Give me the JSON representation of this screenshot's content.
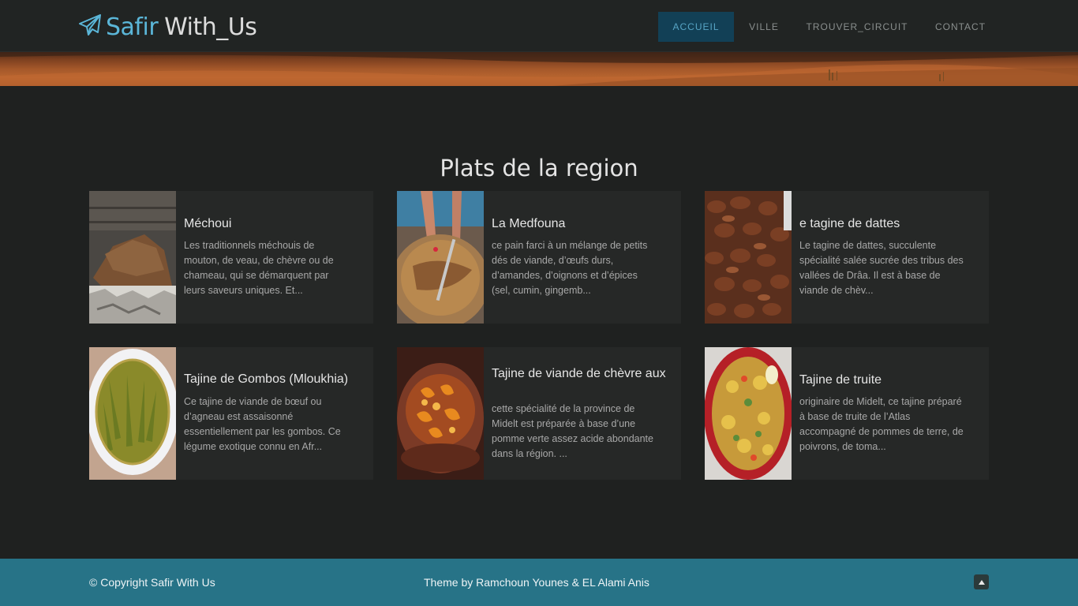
{
  "brand": {
    "name_part1": "Safir",
    "name_part2": "With_Us",
    "icon": "paper-plane-icon",
    "accent": "#5bb6d8"
  },
  "nav": {
    "items": [
      {
        "label": "ACCUEIL",
        "active": true
      },
      {
        "label": "VILLE",
        "active": false
      },
      {
        "label": "TROUVER_CIRCUIT",
        "active": false
      },
      {
        "label": "CONTACT",
        "active": false
      }
    ]
  },
  "main": {
    "title": "Plats de la region",
    "cards": [
      {
        "title": "Méchoui",
        "desc": "Les traditionnels méchouis de mouton, de veau, de chèvre ou de chameau, qui se démarquent par leurs saveurs uniques. Et..."
      },
      {
        "title": "La Medfouna",
        "desc": "ce pain farci à un mélange de petits dés de viande, d’œufs durs, d’amandes, d’oignons et d’épices (sel, cumin, gingemb..."
      },
      {
        "title": "e tagine de dattes",
        "desc": "Le tagine de dattes, succulente spécialité salée sucrée des tribus des vallées de Drâa. Il est à base de viande de chèv..."
      },
      {
        "title": "Tajine de Gombos (Mloukhia)",
        "desc": "Ce tajine de viande de bœuf ou d’agneau est assaisonné essentiellement par les gombos. Ce légume exotique connu en Afr..."
      },
      {
        "title": "Tajine de viande de chèvre aux",
        "desc": "cette spécialité de la province de Midelt est préparée à base d’une pomme verte assez acide abondante dans la région. ..."
      },
      {
        "title": "Tajine de truite",
        "desc": "originaire de Midelt, ce tajine préparé à base de truite de l’Atlas accompagné de pommes de terre, de poivrons, de toma..."
      }
    ]
  },
  "footer": {
    "copyright": "© Copyright Safir With Us",
    "theme": "Theme by  Ramchoun Younes & EL Alami Anis",
    "color": "#277387"
  }
}
